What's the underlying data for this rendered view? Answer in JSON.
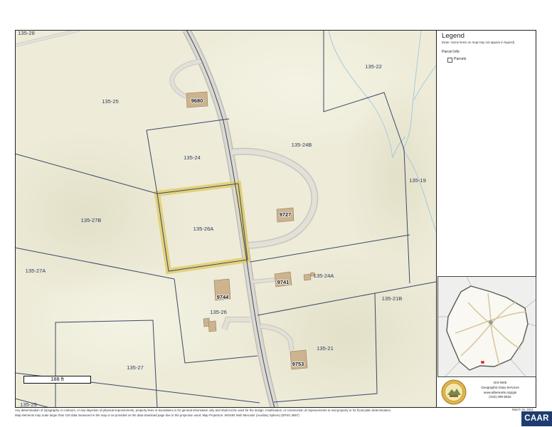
{
  "map": {
    "parcels": [
      {
        "id": "135-28"
      },
      {
        "id": "135-25"
      },
      {
        "id": "135-22"
      },
      {
        "id": "135-24B"
      },
      {
        "id": "135-24"
      },
      {
        "id": "135-19"
      },
      {
        "id": "135-27B"
      },
      {
        "id": "135-26A",
        "highlighted": true
      },
      {
        "id": "135-27A"
      },
      {
        "id": "135-24A"
      },
      {
        "id": "135-21B"
      },
      {
        "id": "135-26"
      },
      {
        "id": "135-21"
      },
      {
        "id": "135-27"
      },
      {
        "id": "135-29"
      }
    ],
    "addresses": [
      "9680",
      "9727",
      "9741",
      "9744",
      "9753"
    ],
    "scale_bar": "188 ft"
  },
  "legend": {
    "title": "Legend",
    "note": "(Note: Some items on map may not appear in legend)",
    "section": "Parcel Info",
    "items": [
      {
        "label": "Parcels",
        "icon": "parcel-symbol-icon"
      }
    ]
  },
  "overview_map": {
    "icon": "county-overview-map",
    "marker_color": "#e02020"
  },
  "branding": {
    "logo_icon": "county-seal-logo",
    "lines": [
      "GIS-Web",
      "Geographic Data Services",
      "www.albemarle.org/gis",
      "(434) 296-5832"
    ],
    "badge": "CAAR"
  },
  "footer": {
    "disclaimer": "Any determination of topography or contours, or any depiction of physical improvements, property lines or boundaries is for general information only and shall not be used for the design, modification, or construction of improvements to real property or for flood plain determination.",
    "projection_note": "Map elements may scale larger than GIS data measured in the map or as provided on the data download page due to the projection used. Map Projection: WGS84 Web Mercator (Auxiliary Sphere) (EPSG 3857)",
    "date": "March 15, 2021"
  },
  "colors": {
    "map_background": "#eeecd9",
    "parcel_boundary": "#3b4768",
    "highlight": "#e0cd6a",
    "building": "#cdb38e",
    "stream": "#9cc7df",
    "road": "#d8d6cc",
    "badge_background": "#1e3c6f"
  }
}
